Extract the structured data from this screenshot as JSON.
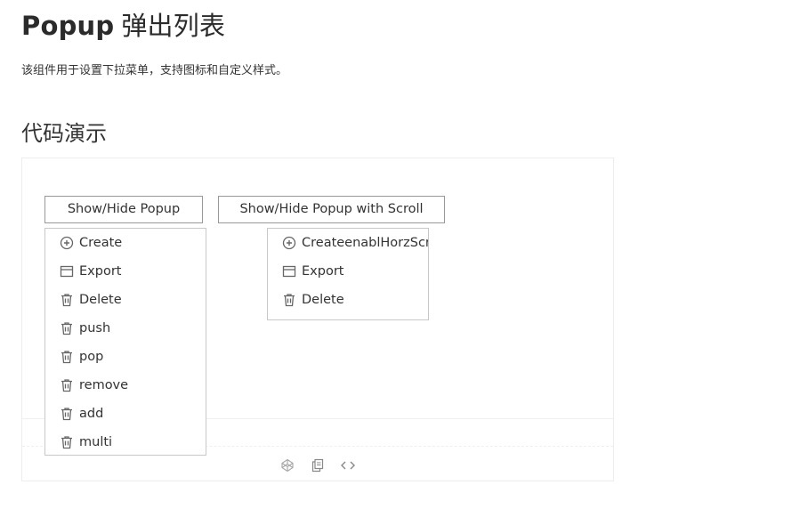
{
  "page": {
    "title_en": "Popup",
    "title_cn": "弹出列表",
    "description": "该组件用于设置下拉菜单，支持图标和自定义样式。",
    "section_title": "代码演示"
  },
  "demo": {
    "button_1_label": "Show/Hide Popup",
    "button_2_label": "Show/Hide Popup with Scroll",
    "popup_1": [
      {
        "label": "Create",
        "icon": "plus-circle-icon"
      },
      {
        "label": "Export",
        "icon": "window-icon"
      },
      {
        "label": "Delete",
        "icon": "trash-icon"
      },
      {
        "label": "push",
        "icon": "trash-icon"
      },
      {
        "label": "pop",
        "icon": "trash-icon"
      },
      {
        "label": "remove",
        "icon": "trash-icon"
      },
      {
        "label": "add",
        "icon": "trash-icon"
      },
      {
        "label": "multi",
        "icon": "trash-icon"
      }
    ],
    "popup_2": [
      {
        "label": "CreateenablHorzScroll",
        "icon": "plus-circle-icon"
      },
      {
        "label": "Export",
        "icon": "window-icon"
      },
      {
        "label": "Delete",
        "icon": "trash-icon"
      }
    ]
  },
  "toolbar": {
    "icons": [
      "codepen-icon",
      "copy-icon",
      "code-icon"
    ]
  },
  "colors": {
    "text": "#333333",
    "border": "#999999",
    "popup_border": "#c8c8c8",
    "icon": "#666666",
    "toolbar_icon": "#a6a6a6"
  }
}
